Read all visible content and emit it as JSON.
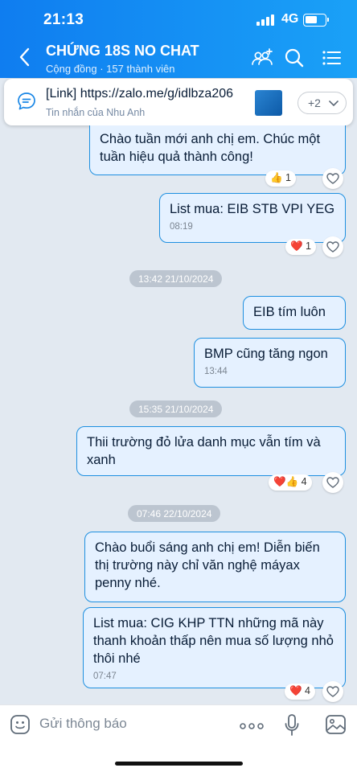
{
  "status": {
    "time": "21:13",
    "network": "4G"
  },
  "header": {
    "title": "CHỨNG 18S NO CHAT",
    "subtitle": "Cộng đồng · 157 thành viên"
  },
  "pinned": {
    "link_text": "[Link] https://zalo.me/g/idlbza206",
    "from": "Tin nhắn của Nhu Anh",
    "more_count": "+2"
  },
  "messages": [
    {
      "text": "Chào tuần mới anh chị em. Chúc một tuần hiệu quả thành công!",
      "reaction": "1"
    },
    {
      "text": "List mua: EIB STB VPI YEG",
      "time": "08:19",
      "reaction": "1"
    },
    {
      "divider": "13:42 21/10/2024"
    },
    {
      "text": "EIB tím luôn"
    },
    {
      "text": "BMP cũng tăng ngon",
      "time": "13:44"
    },
    {
      "divider": "15:35 21/10/2024"
    },
    {
      "text": "Thii trường đỏ lửa danh mục vẫn tím và xanh",
      "reaction": "4"
    },
    {
      "divider": "07:46 22/10/2024"
    },
    {
      "text": "Chào buổi sáng anh chị em! Diễn biến thị trường này chỉ văn nghệ máyax penny nhé."
    },
    {
      "text": "List mua: CIG KHP TTN những mã này thanh khoản thấp nên mua số lượng nhỏ  thôi nhé",
      "time": "07:47",
      "reaction": "4"
    }
  ],
  "composer": {
    "placeholder": "Gửi thông báo"
  },
  "colors": {
    "header": "#1292f3",
    "bubble": "#e5f1ff",
    "bubble_border": "#1d8fe0",
    "background": "#e2e9f1"
  }
}
